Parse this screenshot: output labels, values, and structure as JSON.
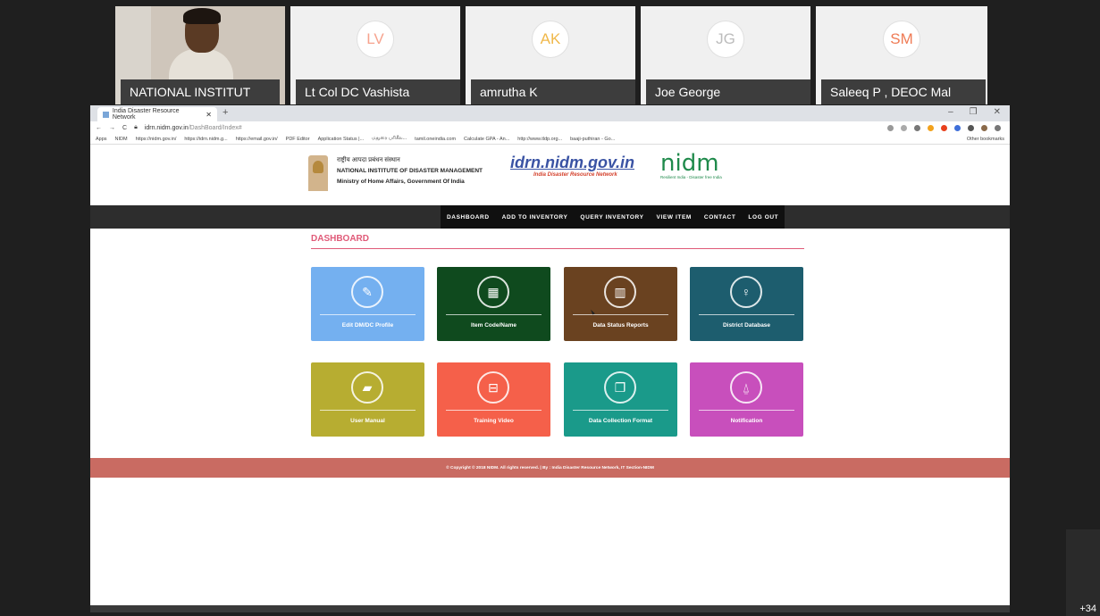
{
  "participants": [
    {
      "name": "NATIONAL INSTITUT",
      "initials": ""
    },
    {
      "name": "Lt Col DC Vashista",
      "initials": "LV",
      "color": "#f6a38e"
    },
    {
      "name": "amrutha K",
      "initials": "AK",
      "color": "#f0b84a"
    },
    {
      "name": "Joe George",
      "initials": "JG",
      "color": "#bcbcbc"
    },
    {
      "name": "Saleeq P , DEOC Mal",
      "initials": "SM",
      "color": "#ef7b55"
    }
  ],
  "more_participants": "+34",
  "browser": {
    "tab_title": "India Disaster Resource Network",
    "url_host": "idrn.nidm.gov.in",
    "url_path": "/DashBoard/Index#",
    "bookmarks": [
      "Apps",
      "NIDM",
      "https://nidm.gov.in/",
      "https://idrn.nidm.g...",
      "https://email.gov.in/",
      "PDF Editor",
      "Application Status |...",
      "மதுரை பரிசீல...",
      "tamil.oneindia.com",
      "Calculate GPA - An...",
      "http://www.tldp.org...",
      "baaji-puthiran - Go..."
    ],
    "other_bookmarks": "Other bookmarks"
  },
  "site": {
    "inst_hindi": "राष्ट्रीय आपदा प्रबंधन संस्थान",
    "inst_name": "NATIONAL INSTITUTE OF DISASTER MANAGEMENT",
    "inst_ministry": "Ministry of Home Affairs, Government Of India",
    "idrn_logo": "idrn.nidm.gov.in",
    "idrn_tag": "India Disaster Resource Network",
    "nidm_logo": "nidm",
    "nidm_tag": "Resilient India - Disaster free India"
  },
  "nav": [
    "DASHBOARD",
    "ADD TO INVENTORY",
    "QUERY INVENTORY",
    "VIEW ITEM",
    "CONTACT",
    "LOG OUT"
  ],
  "dashboard_title": "DASHBOARD",
  "cards": [
    {
      "label": "Edit DM/DC Profile",
      "icon": "edit-icon",
      "glyph": "✎",
      "color": "#74b0f0"
    },
    {
      "label": "Item Code/Name",
      "icon": "grid-icon",
      "glyph": "▦",
      "color": "#0f4a1e"
    },
    {
      "label": "Data Status Reports",
      "icon": "bar-chart-icon",
      "glyph": "▥",
      "color": "#6a4220"
    },
    {
      "label": "District Database",
      "icon": "map-pin-icon",
      "glyph": "♀",
      "color": "#1d5d6e"
    },
    {
      "label": "User Manual",
      "icon": "book-icon",
      "glyph": "▰",
      "color": "#b7ad31"
    },
    {
      "label": "Training Video",
      "icon": "film-icon",
      "glyph": "⊟",
      "color": "#f5604a"
    },
    {
      "label": "Data Collection Format",
      "icon": "copy-icon",
      "glyph": "❐",
      "color": "#1a9a8a"
    },
    {
      "label": "Notification",
      "icon": "bell-icon",
      "glyph": "⍙",
      "color": "#c84fbc"
    }
  ],
  "footer": "© Copyright © 2018 NIDM. All rights reserved. | By : India Disaster Resource Network, IT Section-NIDM"
}
